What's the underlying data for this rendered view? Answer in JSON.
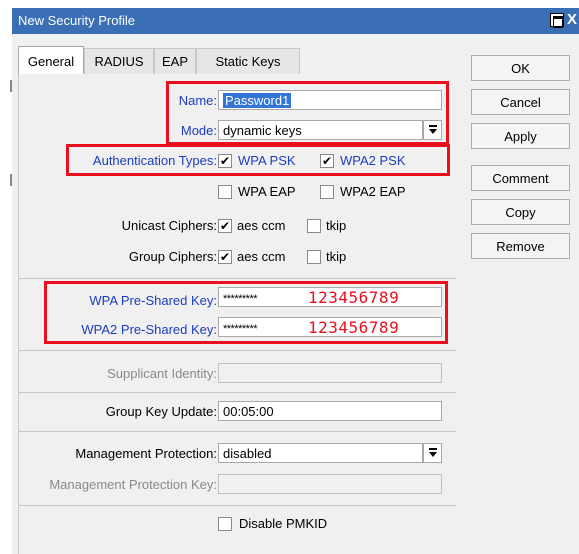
{
  "window": {
    "title": "New Security Profile",
    "maximize_icon": "maximize-icon",
    "close_label": "X"
  },
  "tabs": [
    {
      "label": "General",
      "active": true
    },
    {
      "label": "RADIUS",
      "active": false
    },
    {
      "label": "EAP",
      "active": false
    },
    {
      "label": "Static Keys",
      "active": false
    }
  ],
  "general": {
    "name": {
      "label": "Name:",
      "value": "Password1"
    },
    "mode": {
      "label": "Mode:",
      "value": "dynamic keys"
    },
    "auth_types": {
      "label": "Authentication Types:",
      "wpa_psk": {
        "label": "WPA PSK",
        "checked": true
      },
      "wpa2_psk": {
        "label": "WPA2 PSK",
        "checked": true
      },
      "wpa_eap": {
        "label": "WPA EAP",
        "checked": false
      },
      "wpa2_eap": {
        "label": "WPA2 EAP",
        "checked": false
      }
    },
    "unicast": {
      "label": "Unicast Ciphers:",
      "aes": {
        "label": "aes ccm",
        "checked": true
      },
      "tkip": {
        "label": "tkip",
        "checked": false
      }
    },
    "group": {
      "label": "Group Ciphers:",
      "aes": {
        "label": "aes ccm",
        "checked": true
      },
      "tkip": {
        "label": "tkip",
        "checked": false
      }
    },
    "wpa_key": {
      "label": "WPA Pre-Shared Key:",
      "masked": "*********",
      "annotation": "123456789"
    },
    "wpa2_key": {
      "label": "WPA2 Pre-Shared Key:",
      "masked": "*********",
      "annotation": "123456789"
    },
    "supplicant": {
      "label": "Supplicant Identity:",
      "value": ""
    },
    "group_key_update": {
      "label": "Group Key Update:",
      "value": "00:05:00"
    },
    "mgmt_protection": {
      "label": "Management Protection:",
      "value": "disabled"
    },
    "mgmt_key": {
      "label": "Management Protection Key:",
      "value": ""
    },
    "pmkid": {
      "label": "Disable PMKID",
      "checked": false
    }
  },
  "buttons": {
    "ok": "OK",
    "cancel": "Cancel",
    "apply": "Apply",
    "comment": "Comment",
    "copy": "Copy",
    "remove": "Remove"
  },
  "check_glyph": "✔",
  "colors": {
    "title_bar": "#3a6fb5",
    "highlight": "#e8101e",
    "label_blue": "#1d3dbf"
  }
}
